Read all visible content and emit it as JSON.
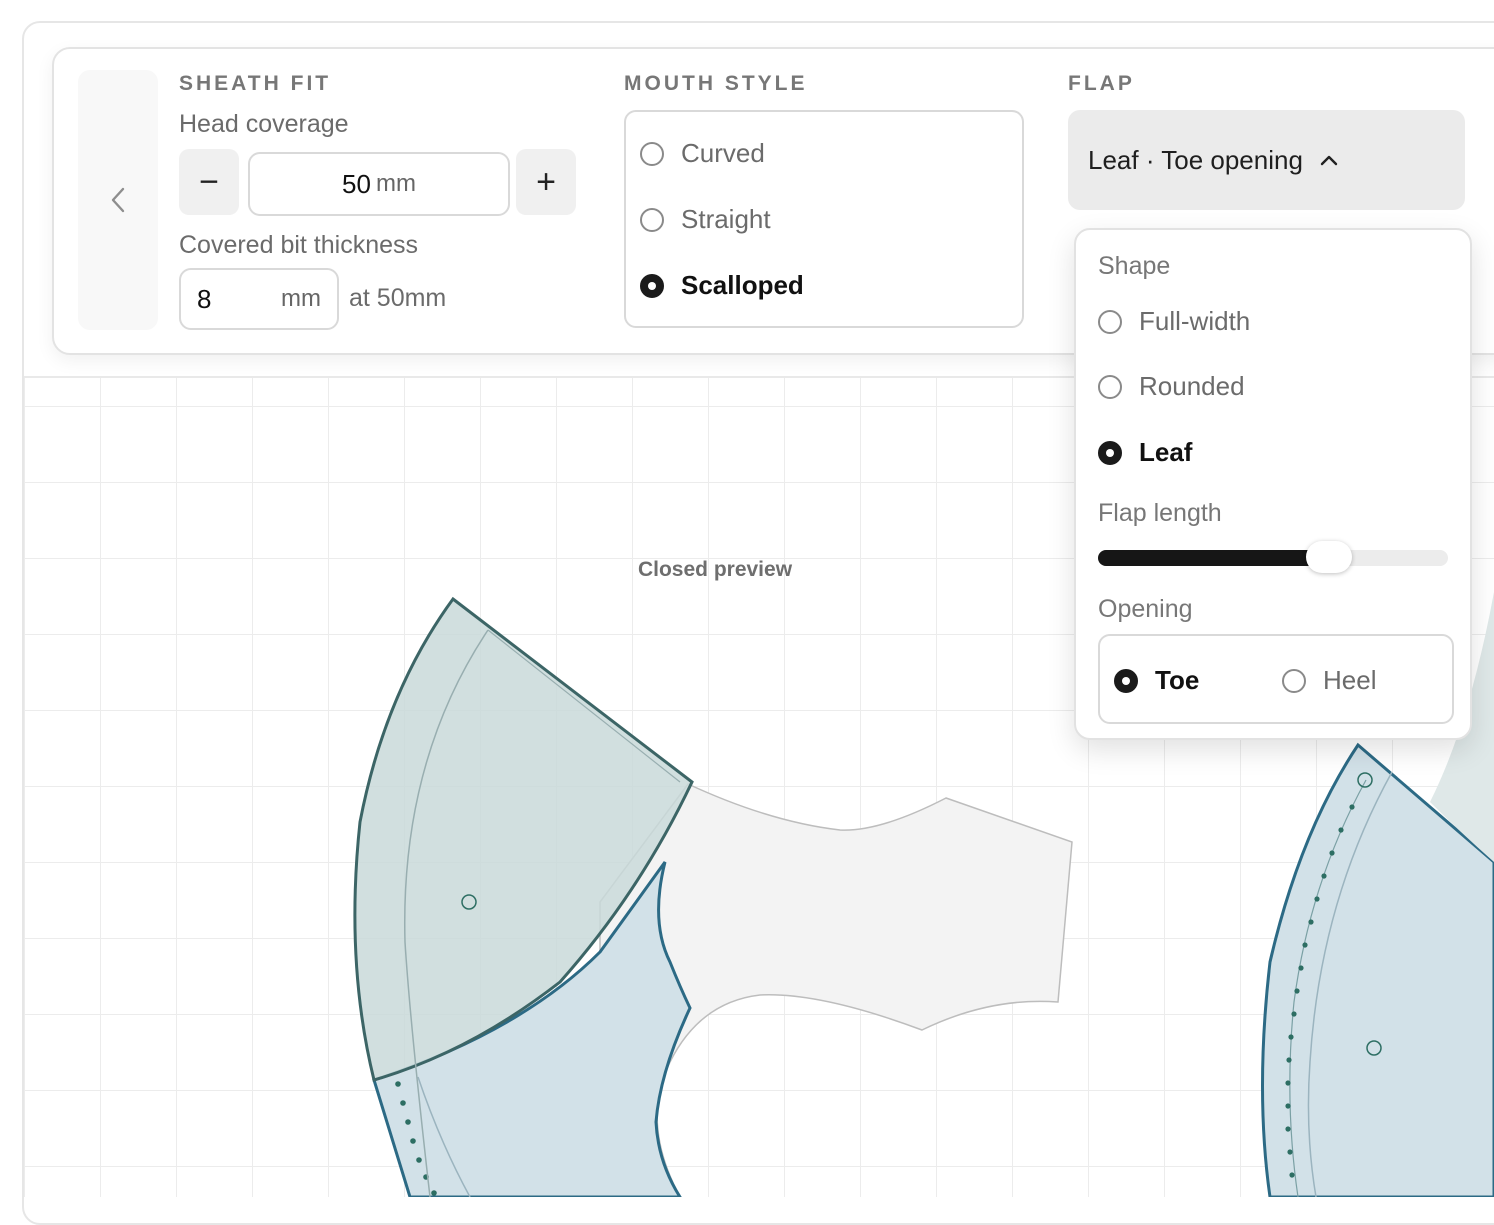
{
  "sheath_fit": {
    "title": "SHEATH FIT",
    "head_coverage": {
      "label": "Head coverage",
      "value": "50",
      "unit": "mm",
      "decrement": "−",
      "increment": "+"
    },
    "covered_bit_thickness": {
      "label": "Covered bit thickness",
      "value": "8",
      "unit": "mm",
      "suffix": "at 50mm"
    }
  },
  "mouth_style": {
    "title": "MOUTH STYLE",
    "options": [
      {
        "label": "Curved",
        "selected": false
      },
      {
        "label": "Straight",
        "selected": false
      },
      {
        "label": "Scalloped",
        "selected": true
      }
    ]
  },
  "flap": {
    "title": "FLAP",
    "summary": "Leaf · Toe opening",
    "popover": {
      "shape_label": "Shape",
      "shapes": [
        {
          "label": "Full-width",
          "selected": false
        },
        {
          "label": "Rounded",
          "selected": false
        },
        {
          "label": "Leaf",
          "selected": true
        }
      ],
      "flap_length_label": "Flap length",
      "flap_length_fraction": 0.66,
      "opening_label": "Opening",
      "openings": [
        {
          "label": "Toe",
          "selected": true
        },
        {
          "label": "Heel",
          "selected": false
        }
      ]
    }
  },
  "canvas": {
    "preview_label": "Closed preview"
  },
  "icons": {
    "prev": "chevron-left-icon",
    "dropdown": "chevron-up-icon"
  },
  "colors": {
    "sheath_fill": "#d2e1e8",
    "sheath_stroke": "#2c6a85",
    "flap_fill": "#c9d9d9",
    "flap_stroke": "#3c6566",
    "axe_fill": "#f3f3f3",
    "stitch": "#2d6e63"
  }
}
